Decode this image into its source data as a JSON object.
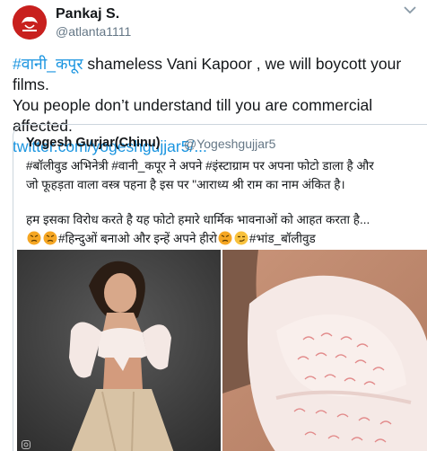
{
  "tweet": {
    "author_name": "Pankaj S.",
    "author_handle": "@atlanta1111",
    "text_hashtag": "#वानी_कपूर",
    "text_line1_rest": " shameless Vani Kapoor , we will boycott your films.",
    "text_line2": "You people don’t understand till you are commercial affected.",
    "link": "twitter.com/yogeshgujjar5/...",
    "icons": [
      "avatar-logo",
      "chevron-down-icon"
    ]
  },
  "quote": {
    "author_name": "Yogesh Gurjar(Chinu)",
    "author_handle": "@Yogeshgujjar5",
    "line1": "#बॉलीवुड अभिनेत्री #वानी_कपूर ने अपने #इंस्टाग्राम पर अपना फोटो डाला है और",
    "line2": "जो फूहड़ता वाला वस्त्र पहना है इस पर \"आराध्य श्री राम का नाम अंकित है।",
    "line3": "हम इसका विरोध करते है यह फोटो हमारे धार्मिक भावनाओं को आहत करता है...",
    "line4_part1": "#हिन्दुओं बनाओ और इन्हें अपने हीरो",
    "line4_part2": "#भांड_बॉलीवुड",
    "emojis": [
      "angry-face",
      "angry-face",
      "angry-face",
      "smirking-face"
    ]
  },
  "colors": {
    "link_blue": "#1b95e0",
    "avatar_red": "#c8201e",
    "border": "#ccd6dd",
    "secondary_text": "#657786"
  }
}
